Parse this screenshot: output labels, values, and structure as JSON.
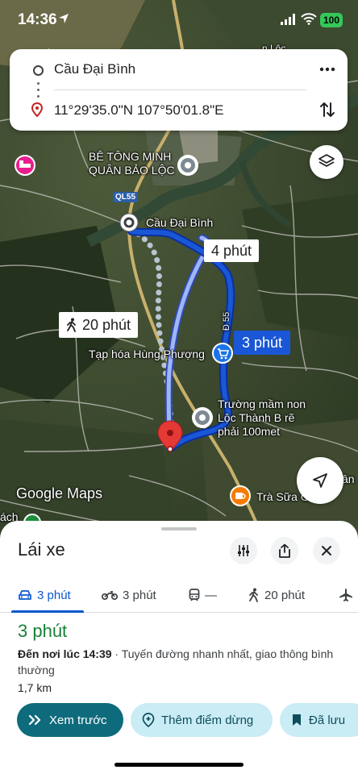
{
  "status_bar": {
    "time": "14:36",
    "battery": "100"
  },
  "search": {
    "origin": "Cầu Đại Bình",
    "destination": "11°29'35.0\"N 107°50'01.8\"E"
  },
  "map": {
    "labels": {
      "poi_concrete_line1": "BÊ TÔNG MINH",
      "poi_concrete_line2": "QUÂN BẢO LỘC",
      "road_ql55": "QL55",
      "bridge": "Cầu Đại Bình",
      "grocery": "Tạp hóa Hùng Phượng",
      "school_line1": "Trường mầm non",
      "school_line2": "Lộc Thành B rẽ",
      "school_line3": "phải 100met",
      "cafe": "Trà Sữa G",
      "road_d55": "Đ 55",
      "top_fragment": "n Lộc",
      "right_fragment": "ân",
      "left_fragment": "ách"
    },
    "durations": {
      "alt_route": "4 phút",
      "selected_route": "3 phút",
      "walking": "20 phút"
    },
    "logo": "Google Maps"
  },
  "sheet": {
    "title": "Lái xe",
    "modes": [
      {
        "name": "car",
        "label": "3 phút",
        "active": true
      },
      {
        "name": "motorbike",
        "label": "3 phút",
        "active": false
      },
      {
        "name": "transit",
        "label": "—",
        "active": false
      },
      {
        "name": "walk",
        "label": "20 phút",
        "active": false
      }
    ],
    "route_time": "3 phút",
    "arrival": "Đến nơi lúc 14:39",
    "route_note": " · Tuyến đường nhanh nhất, giao thông bình thường",
    "distance": "1,7 km",
    "actions": {
      "preview": "Xem trước",
      "add_stop": "Thêm điểm dừng",
      "saved": "Đã lưu"
    }
  },
  "colors": {
    "route_selected": "#1a57d6",
    "route_alt": "#9fb6f5",
    "accent_green": "#188038",
    "primary_chip": "#0e6b7c"
  }
}
